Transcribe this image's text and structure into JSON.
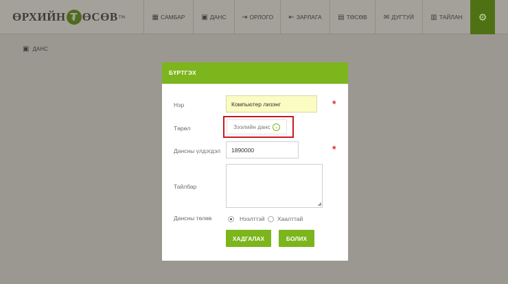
{
  "header": {
    "logo": {
      "part1": "ӨРХИЙН",
      "badge": "₮",
      "part2": "ӨСӨВ",
      "tm": "TM"
    },
    "nav": [
      {
        "label": "САМБАР",
        "icon": "grid-icon"
      },
      {
        "label": "ДАНС",
        "icon": "wallet-icon"
      },
      {
        "label": "ОРЛОГО",
        "icon": "sign-in-icon"
      },
      {
        "label": "ЗАРЛАГА",
        "icon": "sign-out-icon"
      },
      {
        "label": "ТӨСӨВ",
        "icon": "calculator-icon"
      },
      {
        "label": "ДУГТУЙ",
        "icon": "envelope-icon"
      },
      {
        "label": "ТАЙЛАН",
        "icon": "bar-chart-icon"
      }
    ],
    "settings_icon": "gear-icon"
  },
  "page": {
    "title": "ДАНС",
    "icon": "wallet-icon"
  },
  "modal": {
    "title": "БҮРТГЭХ",
    "fields": {
      "name_label": "Нэр",
      "name_value": "Компьютер лизэнг",
      "type_label": "Төрөл",
      "type_value": "Зээлийн данс",
      "balance_label": "Дансны үлдэгдэл",
      "balance_value": "1890000",
      "description_label": "Тайлбар",
      "description_value": "",
      "status_label": "Дансны төлөв",
      "status_options": [
        "Нээлттэй",
        "Хаалттай"
      ],
      "status_selected": "Нээлттэй"
    },
    "required_mark": "*",
    "buttons": {
      "save": "ХАДГАЛАХ",
      "cancel": "БОЛИХ"
    }
  },
  "colors": {
    "accent": "#7cb51c",
    "accent_dark": "#4e7213",
    "required": "#e32a2a",
    "highlight": "#c9171e"
  }
}
